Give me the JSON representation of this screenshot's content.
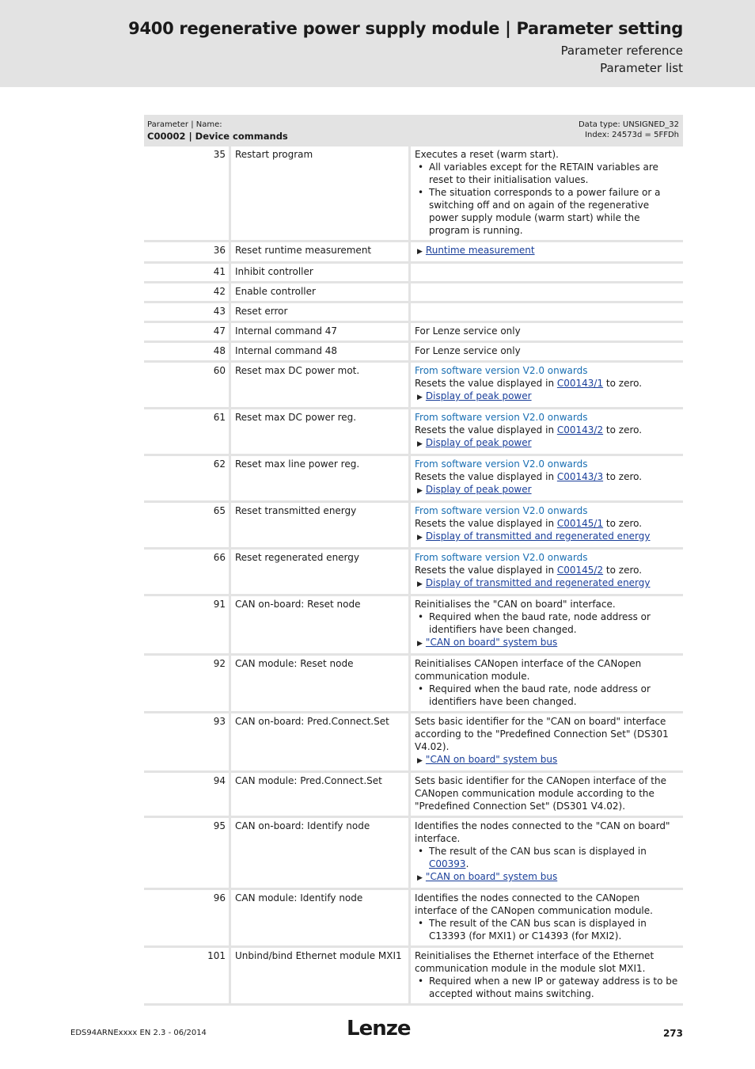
{
  "header": {
    "title": "9400 regenerative power supply module | Parameter setting",
    "sub1": "Parameter reference",
    "sub2": "Parameter list"
  },
  "table": {
    "head_l1": "Parameter | Name:",
    "head_l2": "C00002 | Device commands",
    "head_r1": "Data type: UNSIGNED_32",
    "head_r2": "Index: 24573d = 5FFDh",
    "rows": [
      {
        "n": "35",
        "name": "Restart program",
        "lines": [
          {
            "t": "text",
            "v": "Executes a reset (warm start)."
          },
          {
            "t": "bullet",
            "v": "All variables except for the RETAIN variables are reset to their initialisation values."
          },
          {
            "t": "bullet",
            "v": "The situation corresponds to a power failure or a switching off and on again of the regenerative power supply module (warm start) while the program is running."
          }
        ]
      },
      {
        "n": "36",
        "name": "Reset runtime measurement",
        "lines": [
          {
            "t": "link",
            "v": "Runtime measurement"
          }
        ]
      },
      {
        "n": "41",
        "name": "Inhibit controller",
        "lines": []
      },
      {
        "n": "42",
        "name": "Enable controller",
        "lines": []
      },
      {
        "n": "43",
        "name": "Reset error",
        "lines": []
      },
      {
        "n": "47",
        "name": "Internal command 47",
        "lines": [
          {
            "t": "text",
            "v": "For Lenze service only"
          }
        ]
      },
      {
        "n": "48",
        "name": "Internal command 48",
        "lines": [
          {
            "t": "text",
            "v": "For Lenze service only"
          }
        ]
      },
      {
        "n": "60",
        "name": "Reset max DC power mot.",
        "lines": [
          {
            "t": "blue",
            "v": "From software version V2.0 onwards"
          },
          {
            "t": "reset",
            "v": "C00143/1"
          },
          {
            "t": "link",
            "v": "Display of peak power"
          }
        ]
      },
      {
        "n": "61",
        "name": "Reset max DC power reg.",
        "lines": [
          {
            "t": "blue",
            "v": "From software version V2.0 onwards"
          },
          {
            "t": "reset",
            "v": "C00143/2"
          },
          {
            "t": "link",
            "v": "Display of peak power"
          }
        ]
      },
      {
        "n": "62",
        "name": "Reset max line power reg.",
        "lines": [
          {
            "t": "blue",
            "v": "From software version V2.0 onwards"
          },
          {
            "t": "reset",
            "v": "C00143/3"
          },
          {
            "t": "link",
            "v": "Display of peak power"
          }
        ]
      },
      {
        "n": "65",
        "name": "Reset transmitted energy",
        "lines": [
          {
            "t": "blue",
            "v": "From software version V2.0 onwards"
          },
          {
            "t": "reset",
            "v": "C00145/1"
          },
          {
            "t": "link",
            "v": "Display of transmitted and regenerated energy"
          }
        ]
      },
      {
        "n": "66",
        "name": "Reset regenerated energy",
        "lines": [
          {
            "t": "blue",
            "v": "From software version V2.0 onwards"
          },
          {
            "t": "reset",
            "v": "C00145/2"
          },
          {
            "t": "link",
            "v": "Display of transmitted and regenerated energy"
          }
        ]
      },
      {
        "n": "91",
        "name": "CAN on-board: Reset node",
        "lines": [
          {
            "t": "text",
            "v": "Reinitialises the \"CAN on board\" interface."
          },
          {
            "t": "bullet",
            "v": "Required when the baud rate, node address or identifiers have been changed."
          },
          {
            "t": "link",
            "v": "\"CAN on board\" system bus"
          }
        ]
      },
      {
        "n": "92",
        "name": "CAN module: Reset node",
        "lines": [
          {
            "t": "text",
            "v": "Reinitialises CANopen interface of the CANopen communication module."
          },
          {
            "t": "bullet",
            "v": "Required when the baud rate, node address or identifiers have been changed."
          }
        ]
      },
      {
        "n": "93",
        "name": "CAN on-board: Pred.Connect.Set",
        "lines": [
          {
            "t": "text",
            "v": "Sets basic identifier for the \"CAN on board\" interface according to the \"Predefined Connection Set\" (DS301 V4.02)."
          },
          {
            "t": "link",
            "v": "\"CAN on board\" system bus"
          }
        ]
      },
      {
        "n": "94",
        "name": "CAN module: Pred.Connect.Set",
        "lines": [
          {
            "t": "text",
            "v": "Sets basic identifier for the CANopen interface of the CANopen communication module according to the \"Predefined Connection Set\" (DS301 V4.02)."
          }
        ]
      },
      {
        "n": "95",
        "name": "CAN on-board: Identify node",
        "lines": [
          {
            "t": "text",
            "v": "Identifies the nodes connected to the \"CAN on board\" interface."
          },
          {
            "t": "bulletlink",
            "v": "The result of the CAN bus scan is displayed in ",
            "l": "C00393"
          },
          {
            "t": "link",
            "v": "\"CAN on board\" system bus"
          }
        ]
      },
      {
        "n": "96",
        "name": "CAN module: Identify node",
        "lines": [
          {
            "t": "text",
            "v": "Identifies the nodes connected to the CANopen interface of the CANopen communication module."
          },
          {
            "t": "bullet",
            "v": "The result of the CAN bus scan is displayed in C13393 (for MXI1) or C14393 (for MXI2)."
          }
        ]
      },
      {
        "n": "101",
        "name": "Unbind/bind Ethernet module MXI1",
        "lines": [
          {
            "t": "text",
            "v": "Reinitialises the Ethernet interface of the Ethernet communication module in the module slot MXI1."
          },
          {
            "t": "bullet",
            "v": "Required when a new IP or gateway address is to be accepted without mains switching."
          }
        ]
      }
    ]
  },
  "texts": {
    "reset_pre": "Resets the value displayed in ",
    "reset_post": " to zero."
  },
  "footer": {
    "doc": "EDS94ARNExxxx EN 2.3 - 06/2014",
    "logo": "Lenze",
    "page": "273"
  }
}
